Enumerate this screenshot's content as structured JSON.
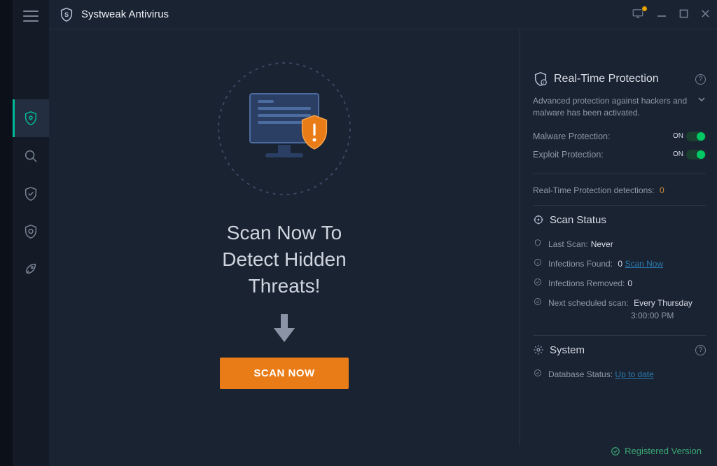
{
  "app": {
    "title": "Systweak Antivirus"
  },
  "sidebar": {
    "items": [
      {
        "name": "home",
        "icon": "shield-lock-icon",
        "active": true
      },
      {
        "name": "scan",
        "icon": "search-icon",
        "active": false
      },
      {
        "name": "protect",
        "icon": "shield-check-icon",
        "active": false
      },
      {
        "name": "extra",
        "icon": "shield-e-icon",
        "active": false
      },
      {
        "name": "boost",
        "icon": "rocket-icon",
        "active": false
      }
    ]
  },
  "hero": {
    "headline": "Scan Now To\nDetect Hidden\nThreats!",
    "scan_button": "SCAN NOW"
  },
  "realtime": {
    "title": "Real-Time Protection",
    "description": "Advanced protection against hackers and malware has been activated.",
    "toggles": {
      "malware": {
        "label": "Malware Protection:",
        "state": "ON"
      },
      "exploit": {
        "label": "Exploit Protection:",
        "state": "ON"
      }
    },
    "detections": {
      "label": "Real-Time Protection detections:",
      "value": "0"
    }
  },
  "scan_status": {
    "title": "Scan Status",
    "last_scan": {
      "label": "Last Scan:",
      "value": "Never"
    },
    "infections_found": {
      "label": "Infections Found:",
      "value": "0",
      "link": "Scan Now"
    },
    "infections_removed": {
      "label": "Infections Removed:",
      "value": "0"
    },
    "next_scan": {
      "label": "Next scheduled scan:",
      "value": "Every Thursday",
      "time": "3:00:00 PM"
    }
  },
  "system": {
    "title": "System",
    "database": {
      "label": "Database Status:",
      "value": "Up to date"
    }
  },
  "footer": {
    "registered": "Registered Version"
  }
}
